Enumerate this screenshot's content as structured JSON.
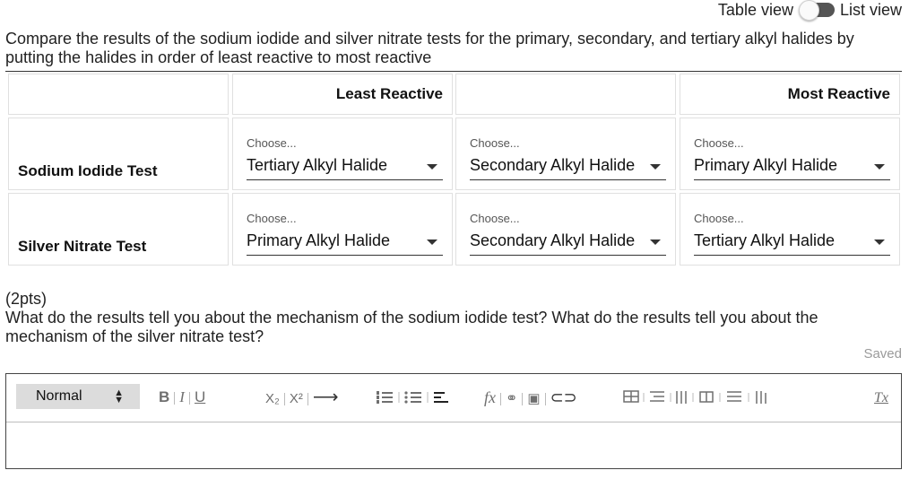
{
  "view_toggle": {
    "left_label": "Table view",
    "right_label": "List view"
  },
  "question1": {
    "prompt": "Compare the results of the sodium iodide and silver nitrate tests for the primary, secondary, and tertiary alkyl halides by putting the halides in order of least reactive to most reactive",
    "headers": {
      "col1": "Least Reactive",
      "col2": "",
      "col3": "Most Reactive"
    },
    "rows": [
      {
        "label": "Sodium Iodide Test",
        "selects": [
          {
            "caption": "Choose...",
            "value": "Tertiary Alkyl Halide"
          },
          {
            "caption": "Choose...",
            "value": "Secondary Alkyl Halide"
          },
          {
            "caption": "Choose...",
            "value": "Primary Alkyl Halide"
          }
        ]
      },
      {
        "label": "Silver Nitrate Test",
        "selects": [
          {
            "caption": "Choose...",
            "value": "Primary Alkyl Halide"
          },
          {
            "caption": "Choose...",
            "value": "Secondary Alkyl Halide"
          },
          {
            "caption": "Choose...",
            "value": "Tertiary Alkyl Halide"
          }
        ]
      }
    ]
  },
  "question2": {
    "points": "(2pts)",
    "prompt": "What do the results tell you about the mechanism of the sodium iodide test? What do the results tell you about the mechanism of the silver nitrate test?",
    "status": "Saved"
  },
  "editor": {
    "style_label": "Normal",
    "bold": "B",
    "italic": "I",
    "underline": "U",
    "subscript": "X₂",
    "superscript": "X²",
    "formula": "fx",
    "clear_format": "Tx",
    "icons": [
      "bold-icon",
      "italic-icon",
      "underline-icon",
      "subscript-icon",
      "superscript-icon",
      "indent-arrow-icon",
      "ordered-list-icon",
      "bullet-list-icon",
      "align-icon",
      "formula-icon",
      "link-icon",
      "image-icon",
      "attachment-icon",
      "table-icon",
      "insert-row-above-icon",
      "insert-column-icon",
      "merge-cells-icon",
      "delete-row-icon",
      "delete-column-icon",
      "clear-format-icon"
    ],
    "body_text": ""
  }
}
